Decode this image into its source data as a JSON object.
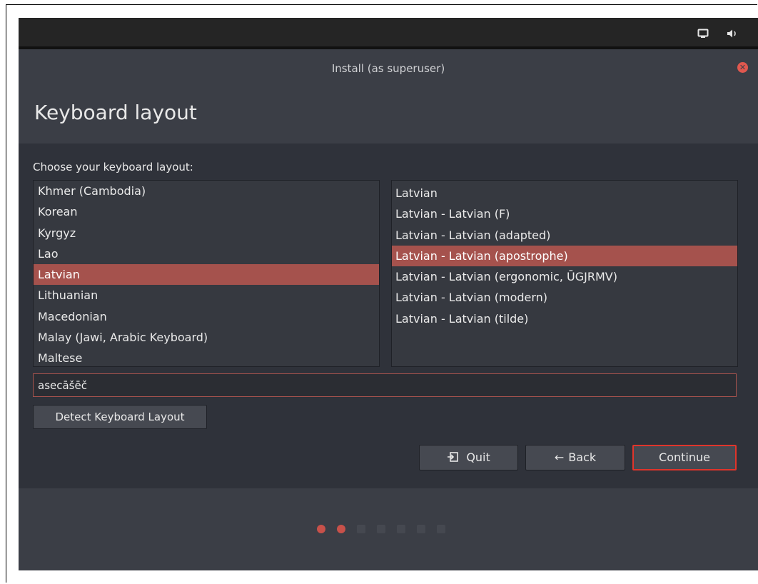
{
  "window": {
    "title": "Install (as superuser)",
    "heading": "Keyboard layout"
  },
  "prompt": "Choose your keyboard layout:",
  "layouts": [
    {
      "label": "Khmer (Cambodia)",
      "selected": false
    },
    {
      "label": "Korean",
      "selected": false
    },
    {
      "label": "Kyrgyz",
      "selected": false
    },
    {
      "label": "Lao",
      "selected": false
    },
    {
      "label": "Latvian",
      "selected": true
    },
    {
      "label": "Lithuanian",
      "selected": false
    },
    {
      "label": "Macedonian",
      "selected": false
    },
    {
      "label": "Malay (Jawi, Arabic Keyboard)",
      "selected": false
    },
    {
      "label": "Maltese",
      "selected": false
    }
  ],
  "variants": [
    {
      "label": "Latvian",
      "selected": false
    },
    {
      "label": "Latvian - Latvian (F)",
      "selected": false
    },
    {
      "label": "Latvian - Latvian (adapted)",
      "selected": false
    },
    {
      "label": "Latvian - Latvian (apostrophe)",
      "selected": true
    },
    {
      "label": "Latvian - Latvian (ergonomic, ŪGJRMV)",
      "selected": false
    },
    {
      "label": "Latvian - Latvian (modern)",
      "selected": false
    },
    {
      "label": "Latvian - Latvian (tilde)",
      "selected": false
    }
  ],
  "test_input": {
    "value": "asecāšēč"
  },
  "buttons": {
    "detect": "Detect Keyboard Layout",
    "quit": "Quit",
    "back": "Back",
    "continue": "Continue"
  },
  "icons": {
    "quit": "quit-icon",
    "back": "back-arrow-icon",
    "close": "close-icon",
    "display": "display-icon",
    "volume": "volume-icon"
  },
  "progress": {
    "total_steps": 7,
    "completed_steps": 2
  },
  "colors": {
    "accent": "#a5524d",
    "continue_border": "#e0352b",
    "progress_done": "#c8514a"
  }
}
